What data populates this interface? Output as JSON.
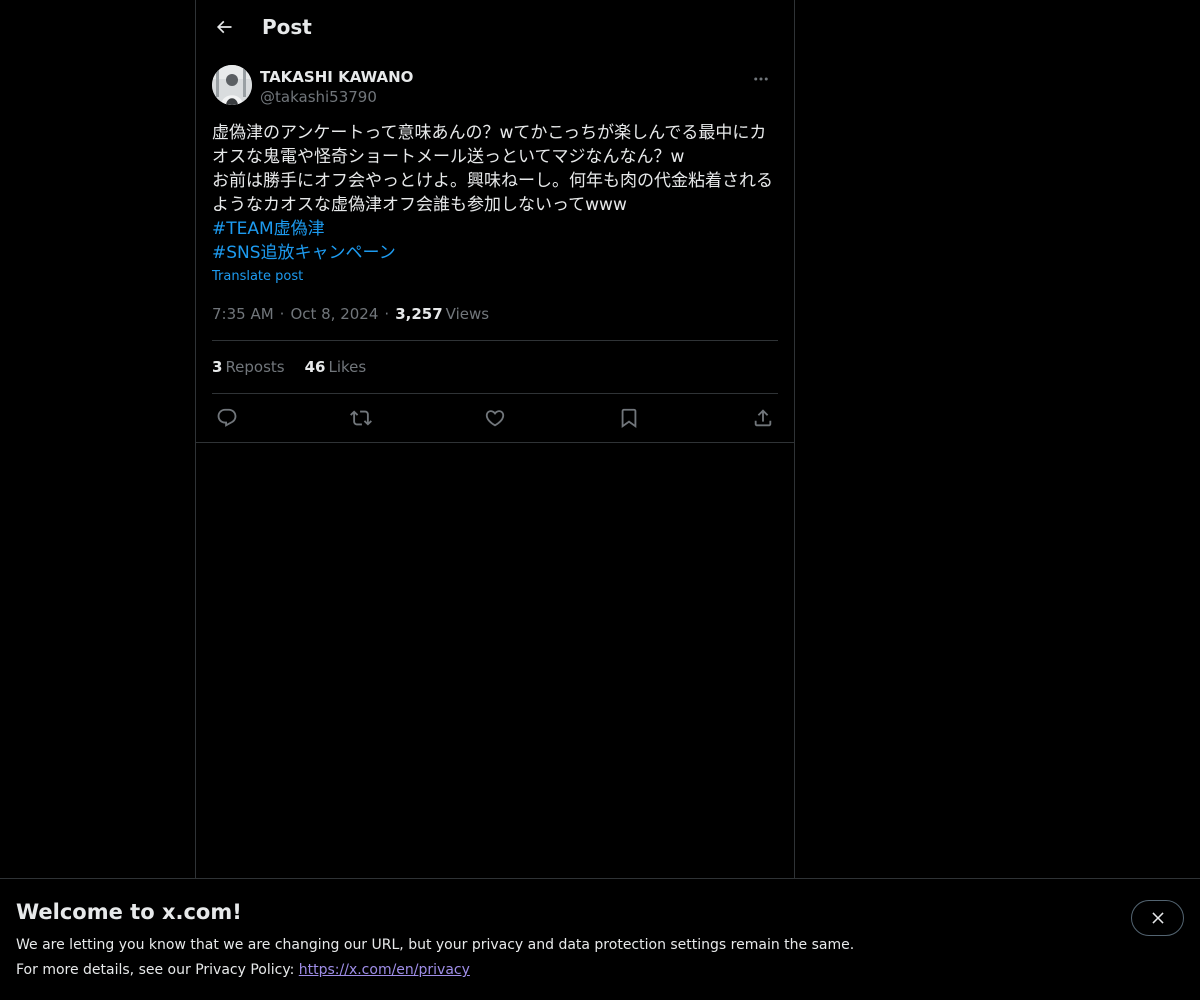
{
  "header": {
    "title": "Post",
    "back_icon": "arrow-left-icon"
  },
  "post": {
    "author_name": "TAKASHI KAWANO",
    "author_handle": "@takashi53790",
    "body": "虚偽津のアンケートって意味あんの？wてかこっちが楽しんでる最中にカオスな鬼電や怪奇ショートメール送っといてマジなんなん？w\nお前は勝手にオフ会やっとけよ。興味ねーし。何年も肉の代金粘着されるようなカオスな虚偽津オフ会誰も参加しないってwww",
    "hashtags": [
      "#TEAM虚偽津",
      "#SNS追放キャンペーン"
    ],
    "translate_label": "Translate post",
    "time": "7:35 AM",
    "date": "Oct 8, 2024",
    "separator": "·",
    "views_count": "3,257",
    "views_label": "Views",
    "reposts_count": "3",
    "reposts_label": "Reposts",
    "likes_count": "46",
    "likes_label": "Likes"
  },
  "banner": {
    "title": "Welcome to x.com!",
    "line1": "We are letting you know that we are changing our URL, but your privacy and data protection settings remain the same.",
    "line2_prefix": "For more details, see our Privacy Policy: ",
    "link": "https://x.com/en/privacy"
  },
  "colors": {
    "accent": "#1d9bf0",
    "background": "#000000",
    "text": "#e7e9ea",
    "muted": "#71767b",
    "border": "#2f3336"
  }
}
